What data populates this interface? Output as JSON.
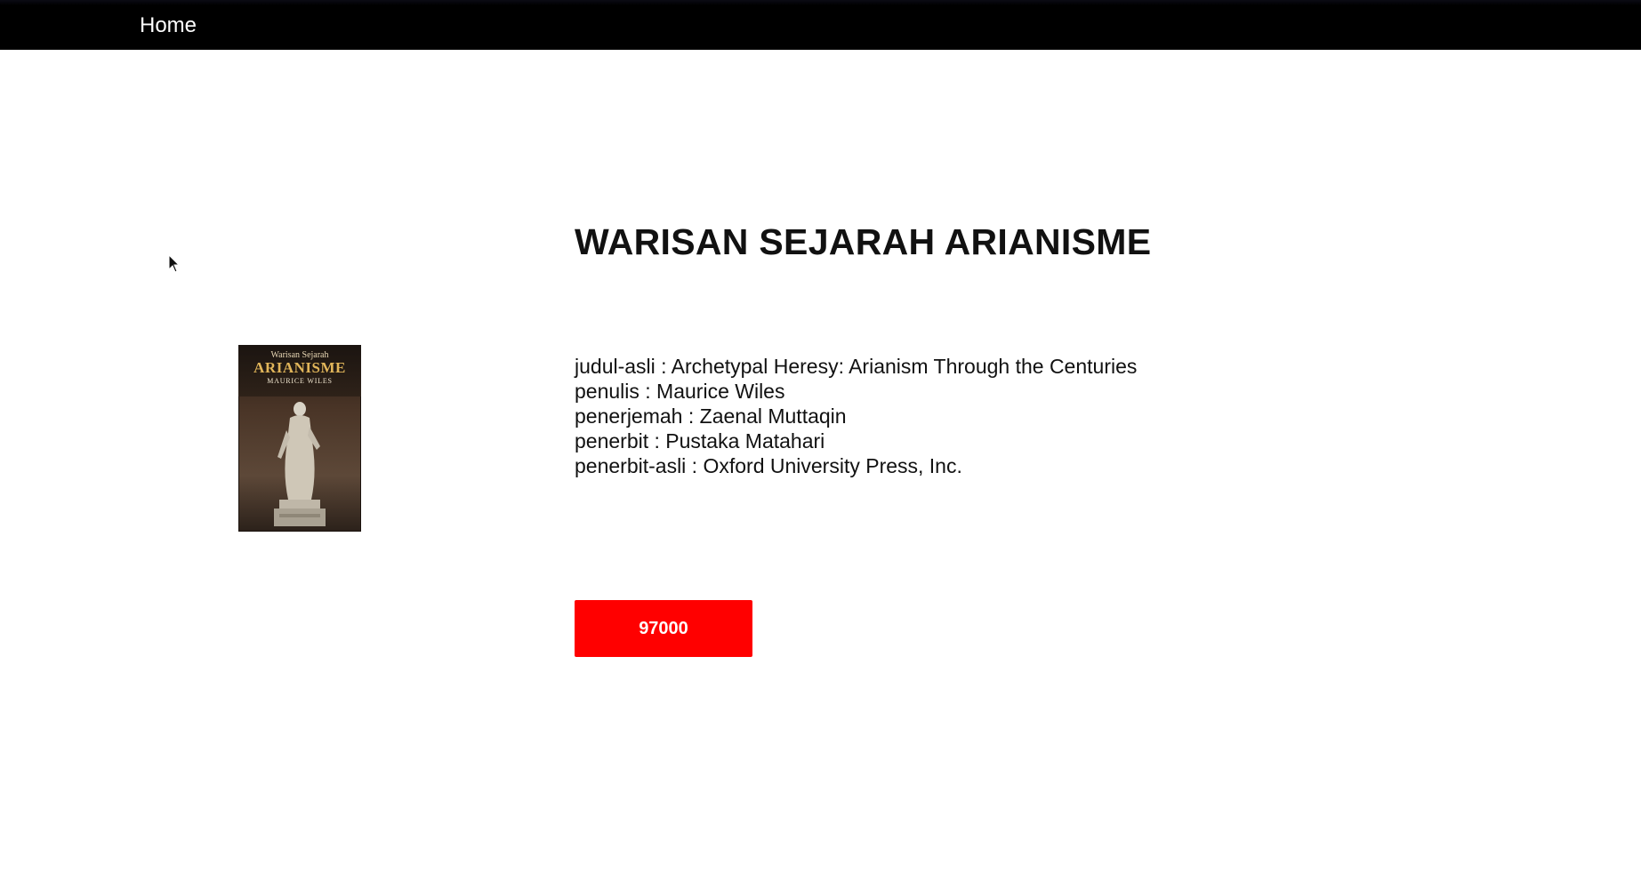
{
  "navbar": {
    "home_label": "Home"
  },
  "book": {
    "title": "WARISAN SEJARAH ARIANISME",
    "cover": {
      "line1": "Warisan Sejarah",
      "line2": "Arianisme",
      "author": "MAURICE WILES"
    },
    "details": [
      "judul-asli : Archetypal Heresy: Arianism Through the Centuries",
      "penulis : Maurice Wiles",
      "penerjemah : Zaenal Muttaqin",
      "penerbit : Pustaka Matahari",
      "penerbit-asli : Oxford University Press, Inc."
    ],
    "price": "97000"
  },
  "colors": {
    "navbar_bg": "#000000",
    "price_button_bg": "#ff0000",
    "text": "#111111"
  }
}
